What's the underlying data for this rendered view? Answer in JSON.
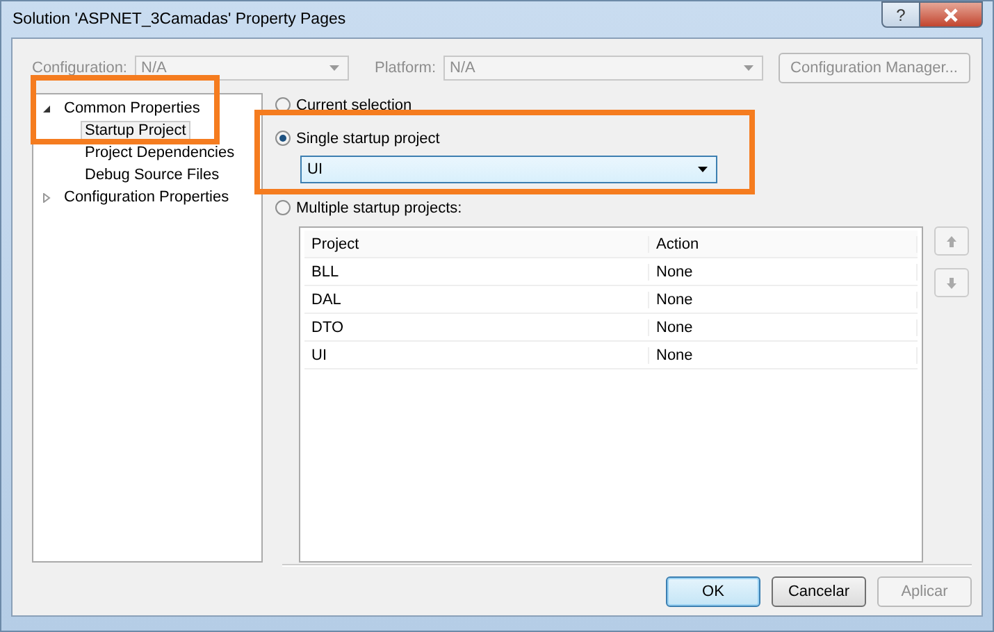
{
  "window": {
    "title": "Solution 'ASPNET_3Camadas' Property Pages",
    "help": "?"
  },
  "toolbar": {
    "disabled": true,
    "fields": [
      {
        "label": "Configuration:",
        "value": "N/A"
      },
      {
        "label": "Platform:",
        "value": "N/A"
      }
    ],
    "button": "Configuration Manager..."
  },
  "tree": [
    {
      "label": "Common Properties",
      "expanded": true,
      "selected": false,
      "children": [
        {
          "label": "Startup Project",
          "selected": true
        },
        {
          "label": "Project Dependencies",
          "selected": false
        },
        {
          "label": "Debug Source Files",
          "selected": false
        }
      ]
    },
    {
      "label": "Configuration Properties",
      "expanded": false,
      "selected": false
    }
  ],
  "options": [
    {
      "label": "Current selection",
      "selected": false
    },
    {
      "label": "Single startup project",
      "selected": true,
      "value": "UI"
    },
    {
      "label": "Multiple startup projects:",
      "selected": false
    }
  ],
  "table": {
    "columns": [
      "Project",
      "Action"
    ],
    "rows": [
      [
        "BLL",
        "None"
      ],
      [
        "DAL",
        "None"
      ],
      [
        "DTO",
        "None"
      ],
      [
        "UI",
        "None"
      ]
    ]
  },
  "buttons": [
    {
      "label": "OK",
      "default": true,
      "disabled": false
    },
    {
      "label": "Cancelar",
      "default": false,
      "disabled": false
    },
    {
      "label": "Aplicar",
      "default": false,
      "disabled": true
    }
  ]
}
